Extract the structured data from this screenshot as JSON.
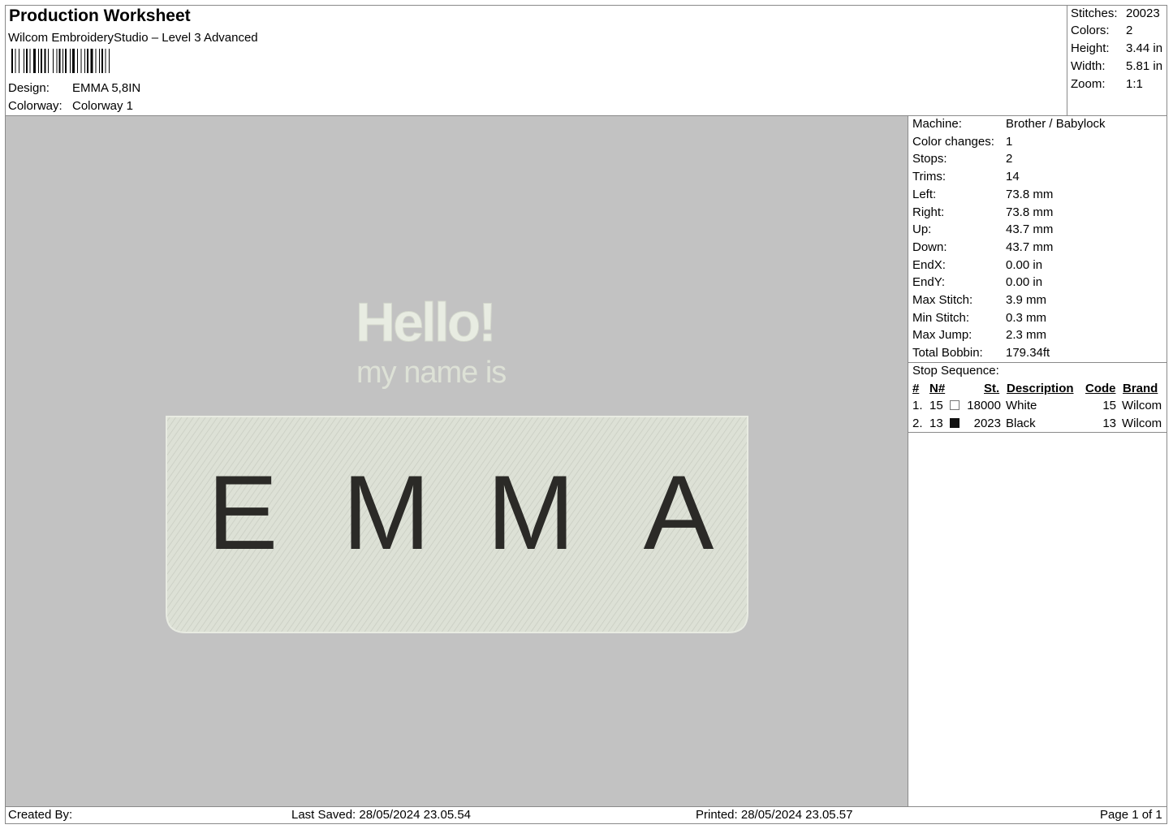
{
  "header": {
    "title": "Production Worksheet",
    "software": "Wilcom EmbroideryStudio – Level 3 Advanced",
    "design_label": "Design:",
    "design_value": "EMMA 5,8IN",
    "colorway_label": "Colorway:",
    "colorway_value": "Colorway 1"
  },
  "summary": {
    "stitches_label": "Stitches:",
    "stitches": "20023",
    "colors_label": "Colors:",
    "colors": "2",
    "height_label": "Height:",
    "height": "3.44 in",
    "width_label": "Width:",
    "width": "5.81 in",
    "zoom_label": "Zoom:",
    "zoom": "1:1"
  },
  "design_preview": {
    "line1": "Hello!",
    "line2": "my name is",
    "name_letters": [
      "E",
      "M",
      "M",
      "A"
    ],
    "patch_color": "#dfe3d8",
    "thread_white": "#e8ece2",
    "thread_black": "#2b2a27"
  },
  "machine_info": [
    {
      "label": "Machine:",
      "value": "Brother / Babylock"
    },
    {
      "label": "Color changes:",
      "value": "1"
    },
    {
      "label": "Stops:",
      "value": "2"
    },
    {
      "label": "Trims:",
      "value": "14"
    },
    {
      "label": "Left:",
      "value": "73.8 mm"
    },
    {
      "label": "Right:",
      "value": "73.8 mm"
    },
    {
      "label": "Up:",
      "value": "43.7 mm"
    },
    {
      "label": "Down:",
      "value": "43.7 mm"
    },
    {
      "label": "EndX:",
      "value": "0.00 in"
    },
    {
      "label": "EndY:",
      "value": "0.00 in"
    },
    {
      "label": "Max Stitch:",
      "value": "3.9 mm"
    },
    {
      "label": "Min Stitch:",
      "value": "0.3 mm"
    },
    {
      "label": "Max Jump:",
      "value": "2.3 mm"
    },
    {
      "label": "Total Bobbin:",
      "value": "179.34ft"
    }
  ],
  "stop_sequence": {
    "title": "Stop Sequence:",
    "headers": {
      "num": "#",
      "needle": "N#",
      "stitches": "St.",
      "description": "Description",
      "code": "Code",
      "brand": "Brand"
    },
    "rows": [
      {
        "num": "1.",
        "needle": "15",
        "swatch": "#ffffff",
        "stitches": "18000",
        "description": "White",
        "code": "15",
        "brand": "Wilcom"
      },
      {
        "num": "2.",
        "needle": "13",
        "swatch": "#111111",
        "stitches": "2023",
        "description": "Black",
        "code": "13",
        "brand": "Wilcom"
      }
    ]
  },
  "footer": {
    "created_by": "Created By:",
    "last_saved": "Last Saved: 28/05/2024 23.05.54",
    "printed": "Printed: 28/05/2024 23.05.57",
    "page": "Page 1 of 1"
  }
}
